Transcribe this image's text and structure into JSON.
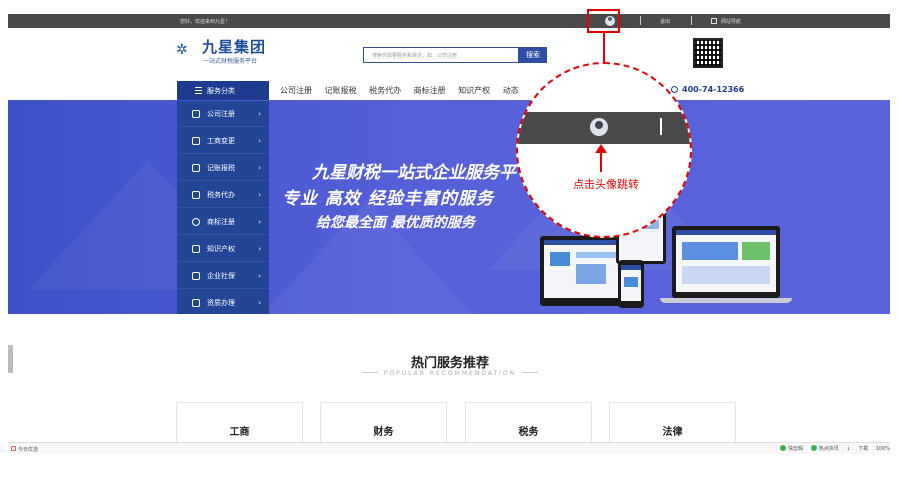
{
  "topbar": {
    "greeting": "您好，欢迎来到九星！",
    "logout": "退出",
    "site_nav": "网站导航"
  },
  "header": {
    "logo_name": "九星集团",
    "logo_subtitle": "一站式财税服务平台",
    "search_placeholder": "搜索你需要服务和资讯，如：公司注册",
    "search_button": "搜索"
  },
  "nav": {
    "category_head": "服务分类",
    "items": [
      "公司注册",
      "记账报税",
      "税务代办",
      "商标注册",
      "知识产权",
      "动态"
    ],
    "phone": "400-74-12366"
  },
  "sidebar": {
    "items": [
      {
        "label": "公司注册",
        "arrow": "›"
      },
      {
        "label": "工商变更",
        "arrow": "›"
      },
      {
        "label": "记账报税",
        "arrow": "›"
      },
      {
        "label": "税务代办",
        "arrow": "›"
      },
      {
        "label": "商标注册",
        "arrow": "›"
      },
      {
        "label": "知识产权",
        "arrow": "›"
      },
      {
        "label": "企业社保",
        "arrow": "›"
      },
      {
        "label": "资质办理",
        "arrow": "›"
      }
    ]
  },
  "banner": {
    "line1": "九星财税一站式企业服务平",
    "line2": "专业  高效  经验丰富的服务",
    "line3": "给您最全面  最优质的服务",
    "slide_count": 2,
    "active_slide": 1
  },
  "hot": {
    "title": "热门服务推荐",
    "subtitle": "POPULAR RECOMMENDATION",
    "cards": [
      "工商",
      "财务",
      "税务",
      "法律"
    ]
  },
  "statusbar": {
    "today": "今日优选",
    "right_items": [
      "快剪辑",
      "热点资讯",
      "↓",
      "下载",
      "100%"
    ]
  },
  "callout": {
    "note": "点击头像跳转"
  },
  "colors": {
    "brand_blue": "#234596",
    "annotation_red": "#e60000",
    "topbar_gray": "#4a4a4a"
  }
}
